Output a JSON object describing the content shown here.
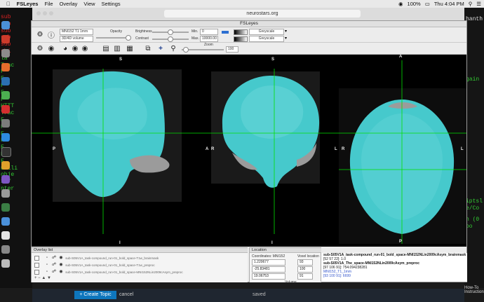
{
  "menubar": {
    "app": "FSLeyes",
    "items": [
      "File",
      "Overlay",
      "View",
      "Settings"
    ],
    "time": "Thu 4:04 PM",
    "battery": "100%"
  },
  "browser": {
    "url": "neurostars.org"
  },
  "terminal": {
    "lines": [
      "sub",
      "sub",
      "sub",
      "sub",
      "sub",
      "shi",
      "la",
      "Trac",
      "F",
      "F",
      "F",
      "F",
      "F",
      "HTTT",
      "Trac",
      "F",
      "F",
      "F",
      "F",
      "F",
      "F",
      "F",
      "urlli",
      "obje",
      "x7f",
      "nter"
    ],
    "right_lines": [
      "hanth",
      "gain",
      "iptsl",
      "e/Co",
      "n (0",
      "oo"
    ]
  },
  "fsleyes": {
    "title": "FSLeyes",
    "toolbar": {
      "space_value": "MNI152 T1 1mm",
      "display_value": "3D/4D volume",
      "opacity_label": "Opacity",
      "brightness_label": "Brightness",
      "contrast_label": "Contrast",
      "min_label": "Min.",
      "max_label": "Max.",
      "min_value": "0",
      "max_value": "10000.00",
      "cmap1": "Greyscale",
      "cmap2": "Greyscale",
      "zoom_label": "Zoom",
      "zoom_value": "100"
    },
    "views": {
      "sag": {
        "top": "S",
        "bottom": "I",
        "left": "P",
        "right": "A"
      },
      "cor": {
        "top": "S",
        "bottom": "I",
        "left": "R",
        "right": "L"
      },
      "axi": {
        "top": "A",
        "bottom": "P",
        "left": "R",
        "right": "L"
      }
    },
    "overlay_list": {
      "title": "Overlay list",
      "rows": [
        "sub-S05V1A_task-compound_run-01_bold_space-T1w_brainmask",
        "sub-S05V1A_task-compound_run-01_bold_space-T1w_preproc",
        "sub-S05V1A_task-compound_run-01_bold_space-MNI152NLin2009cAsym_preproc"
      ]
    },
    "location": {
      "title": "Location",
      "coords_label": "Coordinates: MNI152",
      "voxel_label": "Voxel location",
      "coords": [
        "1.220677",
        "-25.83481",
        "19.06753"
      ],
      "voxels": [
        "93",
        "100",
        "91"
      ],
      "volume_label": "Volume",
      "volume_value": "0"
    },
    "info": [
      "sub-S05V1A_task-compound_run-01_bold_space-MNI152NLin2009cAsym_brainmask",
      "[52 57 22]: 1.0",
      "sub-S05V1A_The_space-MNI152NLin2009cAsym_preproc",
      "[97 106 91]: 754.094238281",
      "MNI152_T1_1mm",
      "[93 100 91]: 6699"
    ]
  },
  "bottombar": {
    "create": "+ Create Topic",
    "cancel": "cancel",
    "saved": "saved"
  },
  "right_note": "How-To Instructions",
  "colors": {
    "overlay": "#3fc8cb",
    "crosshair": "#00e000"
  }
}
